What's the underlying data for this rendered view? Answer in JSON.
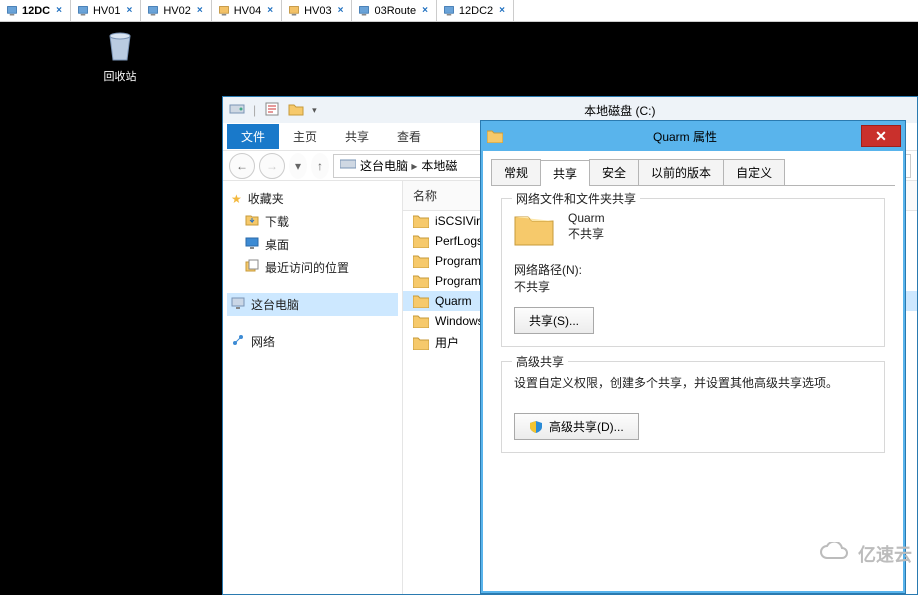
{
  "session_tabs": {
    "active_index": 0,
    "items": [
      {
        "label": "12DC"
      },
      {
        "label": "HV01"
      },
      {
        "label": "HV02"
      },
      {
        "label": "HV04"
      },
      {
        "label": "HV03"
      },
      {
        "label": "03Route"
      },
      {
        "label": "12DC2"
      }
    ]
  },
  "desktop": {
    "recycle_bin": "回收站"
  },
  "explorer": {
    "title": "本地磁盘 (C:)",
    "menu": {
      "file": "文件",
      "home": "主页",
      "share": "共享",
      "view": "查看"
    },
    "breadcrumbs": [
      "这台电脑",
      "本地磁"
    ],
    "list_header": "名称",
    "sidebar": {
      "favorites": "收藏夹",
      "downloads": "下载",
      "desktop": "桌面",
      "recent": "最近访问的位置",
      "this_pc": "这台电脑",
      "network": "网络"
    },
    "files": [
      {
        "name": "iSCSIVirtu"
      },
      {
        "name": "PerfLogs"
      },
      {
        "name": "Program"
      },
      {
        "name": "Program"
      },
      {
        "name": "Quarm",
        "selected": true
      },
      {
        "name": "Windows"
      },
      {
        "name": "用户"
      }
    ]
  },
  "props": {
    "title": "Quarm 属性",
    "tabs": {
      "general": "常规",
      "sharing": "共享",
      "security": "安全",
      "prev": "以前的版本",
      "custom": "自定义"
    },
    "group1": {
      "legend": "网络文件和文件夹共享",
      "folder_name": "Quarm",
      "status": "不共享",
      "net_path_label": "网络路径(N):",
      "net_path_value": "不共享",
      "share_btn": "共享(S)..."
    },
    "group2": {
      "legend": "高级共享",
      "desc": "设置自定义权限，创建多个共享，并设置其他高级共享选项。",
      "adv_btn": "高级共享(D)..."
    }
  },
  "watermark": "亿速云"
}
